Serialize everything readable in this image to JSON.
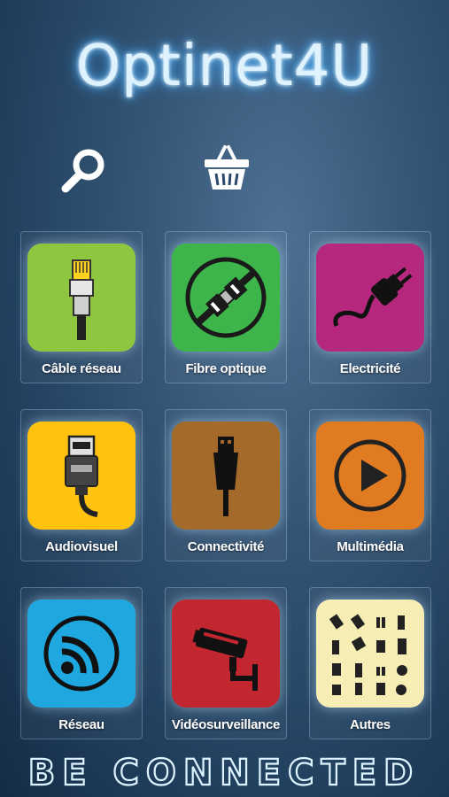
{
  "app": {
    "title": "Optinet4U",
    "tagline": "BE CONNECTED"
  },
  "toolbar": {
    "search_icon": "search-icon",
    "cart_icon": "shopping-basket-icon"
  },
  "tiles": [
    {
      "label": "Câble réseau",
      "color": "#8ec63f",
      "icon": "ethernet-cable-icon"
    },
    {
      "label": "Fibre optique",
      "color": "#3db54a",
      "icon": "fiber-optic-icon"
    },
    {
      "label": "Electricité",
      "color": "#b5287e",
      "icon": "power-plug-icon"
    },
    {
      "label": "Audiovisuel",
      "color": "#ffc20f",
      "icon": "hdmi-cable-icon"
    },
    {
      "label": "Connectivité",
      "color": "#a46a2a",
      "icon": "usb-cable-icon"
    },
    {
      "label": "Multimédia",
      "color": "#e07b21",
      "icon": "play-icon"
    },
    {
      "label": "Réseau",
      "color": "#1fa8e0",
      "icon": "wifi-icon"
    },
    {
      "label": "Vidéosurveillance",
      "color": "#c2262e",
      "icon": "security-camera-icon"
    },
    {
      "label": "Autres",
      "color": "#f6eeb4",
      "icon": "connectors-grid-icon"
    }
  ]
}
